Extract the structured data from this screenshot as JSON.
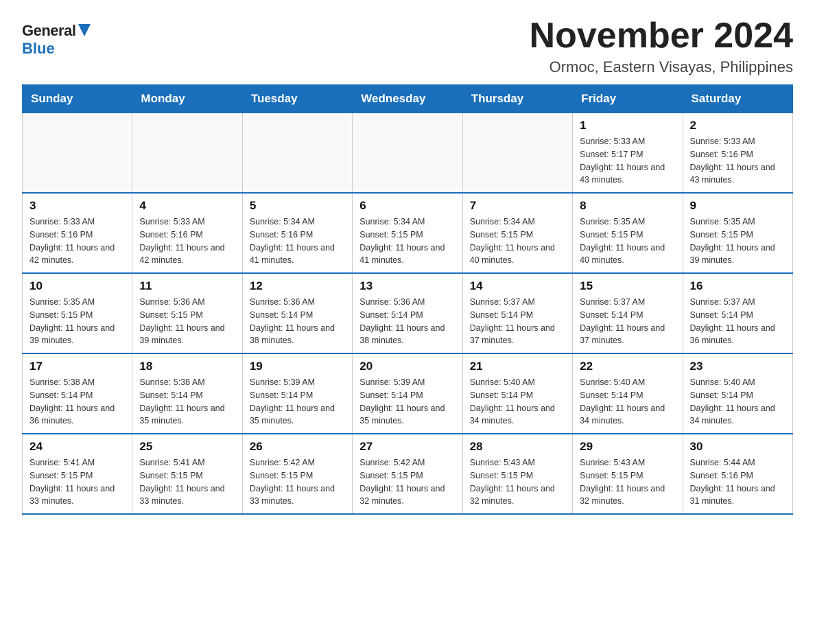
{
  "logo": {
    "general": "General",
    "blue": "Blue"
  },
  "header": {
    "title": "November 2024",
    "subtitle": "Ormoc, Eastern Visayas, Philippines"
  },
  "days_of_week": [
    "Sunday",
    "Monday",
    "Tuesday",
    "Wednesday",
    "Thursday",
    "Friday",
    "Saturday"
  ],
  "weeks": [
    [
      {
        "day": "",
        "info": ""
      },
      {
        "day": "",
        "info": ""
      },
      {
        "day": "",
        "info": ""
      },
      {
        "day": "",
        "info": ""
      },
      {
        "day": "",
        "info": ""
      },
      {
        "day": "1",
        "info": "Sunrise: 5:33 AM\nSunset: 5:17 PM\nDaylight: 11 hours and 43 minutes."
      },
      {
        "day": "2",
        "info": "Sunrise: 5:33 AM\nSunset: 5:16 PM\nDaylight: 11 hours and 43 minutes."
      }
    ],
    [
      {
        "day": "3",
        "info": "Sunrise: 5:33 AM\nSunset: 5:16 PM\nDaylight: 11 hours and 42 minutes."
      },
      {
        "day": "4",
        "info": "Sunrise: 5:33 AM\nSunset: 5:16 PM\nDaylight: 11 hours and 42 minutes."
      },
      {
        "day": "5",
        "info": "Sunrise: 5:34 AM\nSunset: 5:16 PM\nDaylight: 11 hours and 41 minutes."
      },
      {
        "day": "6",
        "info": "Sunrise: 5:34 AM\nSunset: 5:15 PM\nDaylight: 11 hours and 41 minutes."
      },
      {
        "day": "7",
        "info": "Sunrise: 5:34 AM\nSunset: 5:15 PM\nDaylight: 11 hours and 40 minutes."
      },
      {
        "day": "8",
        "info": "Sunrise: 5:35 AM\nSunset: 5:15 PM\nDaylight: 11 hours and 40 minutes."
      },
      {
        "day": "9",
        "info": "Sunrise: 5:35 AM\nSunset: 5:15 PM\nDaylight: 11 hours and 39 minutes."
      }
    ],
    [
      {
        "day": "10",
        "info": "Sunrise: 5:35 AM\nSunset: 5:15 PM\nDaylight: 11 hours and 39 minutes."
      },
      {
        "day": "11",
        "info": "Sunrise: 5:36 AM\nSunset: 5:15 PM\nDaylight: 11 hours and 39 minutes."
      },
      {
        "day": "12",
        "info": "Sunrise: 5:36 AM\nSunset: 5:14 PM\nDaylight: 11 hours and 38 minutes."
      },
      {
        "day": "13",
        "info": "Sunrise: 5:36 AM\nSunset: 5:14 PM\nDaylight: 11 hours and 38 minutes."
      },
      {
        "day": "14",
        "info": "Sunrise: 5:37 AM\nSunset: 5:14 PM\nDaylight: 11 hours and 37 minutes."
      },
      {
        "day": "15",
        "info": "Sunrise: 5:37 AM\nSunset: 5:14 PM\nDaylight: 11 hours and 37 minutes."
      },
      {
        "day": "16",
        "info": "Sunrise: 5:37 AM\nSunset: 5:14 PM\nDaylight: 11 hours and 36 minutes."
      }
    ],
    [
      {
        "day": "17",
        "info": "Sunrise: 5:38 AM\nSunset: 5:14 PM\nDaylight: 11 hours and 36 minutes."
      },
      {
        "day": "18",
        "info": "Sunrise: 5:38 AM\nSunset: 5:14 PM\nDaylight: 11 hours and 35 minutes."
      },
      {
        "day": "19",
        "info": "Sunrise: 5:39 AM\nSunset: 5:14 PM\nDaylight: 11 hours and 35 minutes."
      },
      {
        "day": "20",
        "info": "Sunrise: 5:39 AM\nSunset: 5:14 PM\nDaylight: 11 hours and 35 minutes."
      },
      {
        "day": "21",
        "info": "Sunrise: 5:40 AM\nSunset: 5:14 PM\nDaylight: 11 hours and 34 minutes."
      },
      {
        "day": "22",
        "info": "Sunrise: 5:40 AM\nSunset: 5:14 PM\nDaylight: 11 hours and 34 minutes."
      },
      {
        "day": "23",
        "info": "Sunrise: 5:40 AM\nSunset: 5:14 PM\nDaylight: 11 hours and 34 minutes."
      }
    ],
    [
      {
        "day": "24",
        "info": "Sunrise: 5:41 AM\nSunset: 5:15 PM\nDaylight: 11 hours and 33 minutes."
      },
      {
        "day": "25",
        "info": "Sunrise: 5:41 AM\nSunset: 5:15 PM\nDaylight: 11 hours and 33 minutes."
      },
      {
        "day": "26",
        "info": "Sunrise: 5:42 AM\nSunset: 5:15 PM\nDaylight: 11 hours and 33 minutes."
      },
      {
        "day": "27",
        "info": "Sunrise: 5:42 AM\nSunset: 5:15 PM\nDaylight: 11 hours and 32 minutes."
      },
      {
        "day": "28",
        "info": "Sunrise: 5:43 AM\nSunset: 5:15 PM\nDaylight: 11 hours and 32 minutes."
      },
      {
        "day": "29",
        "info": "Sunrise: 5:43 AM\nSunset: 5:15 PM\nDaylight: 11 hours and 32 minutes."
      },
      {
        "day": "30",
        "info": "Sunrise: 5:44 AM\nSunset: 5:16 PM\nDaylight: 11 hours and 31 minutes."
      }
    ]
  ]
}
